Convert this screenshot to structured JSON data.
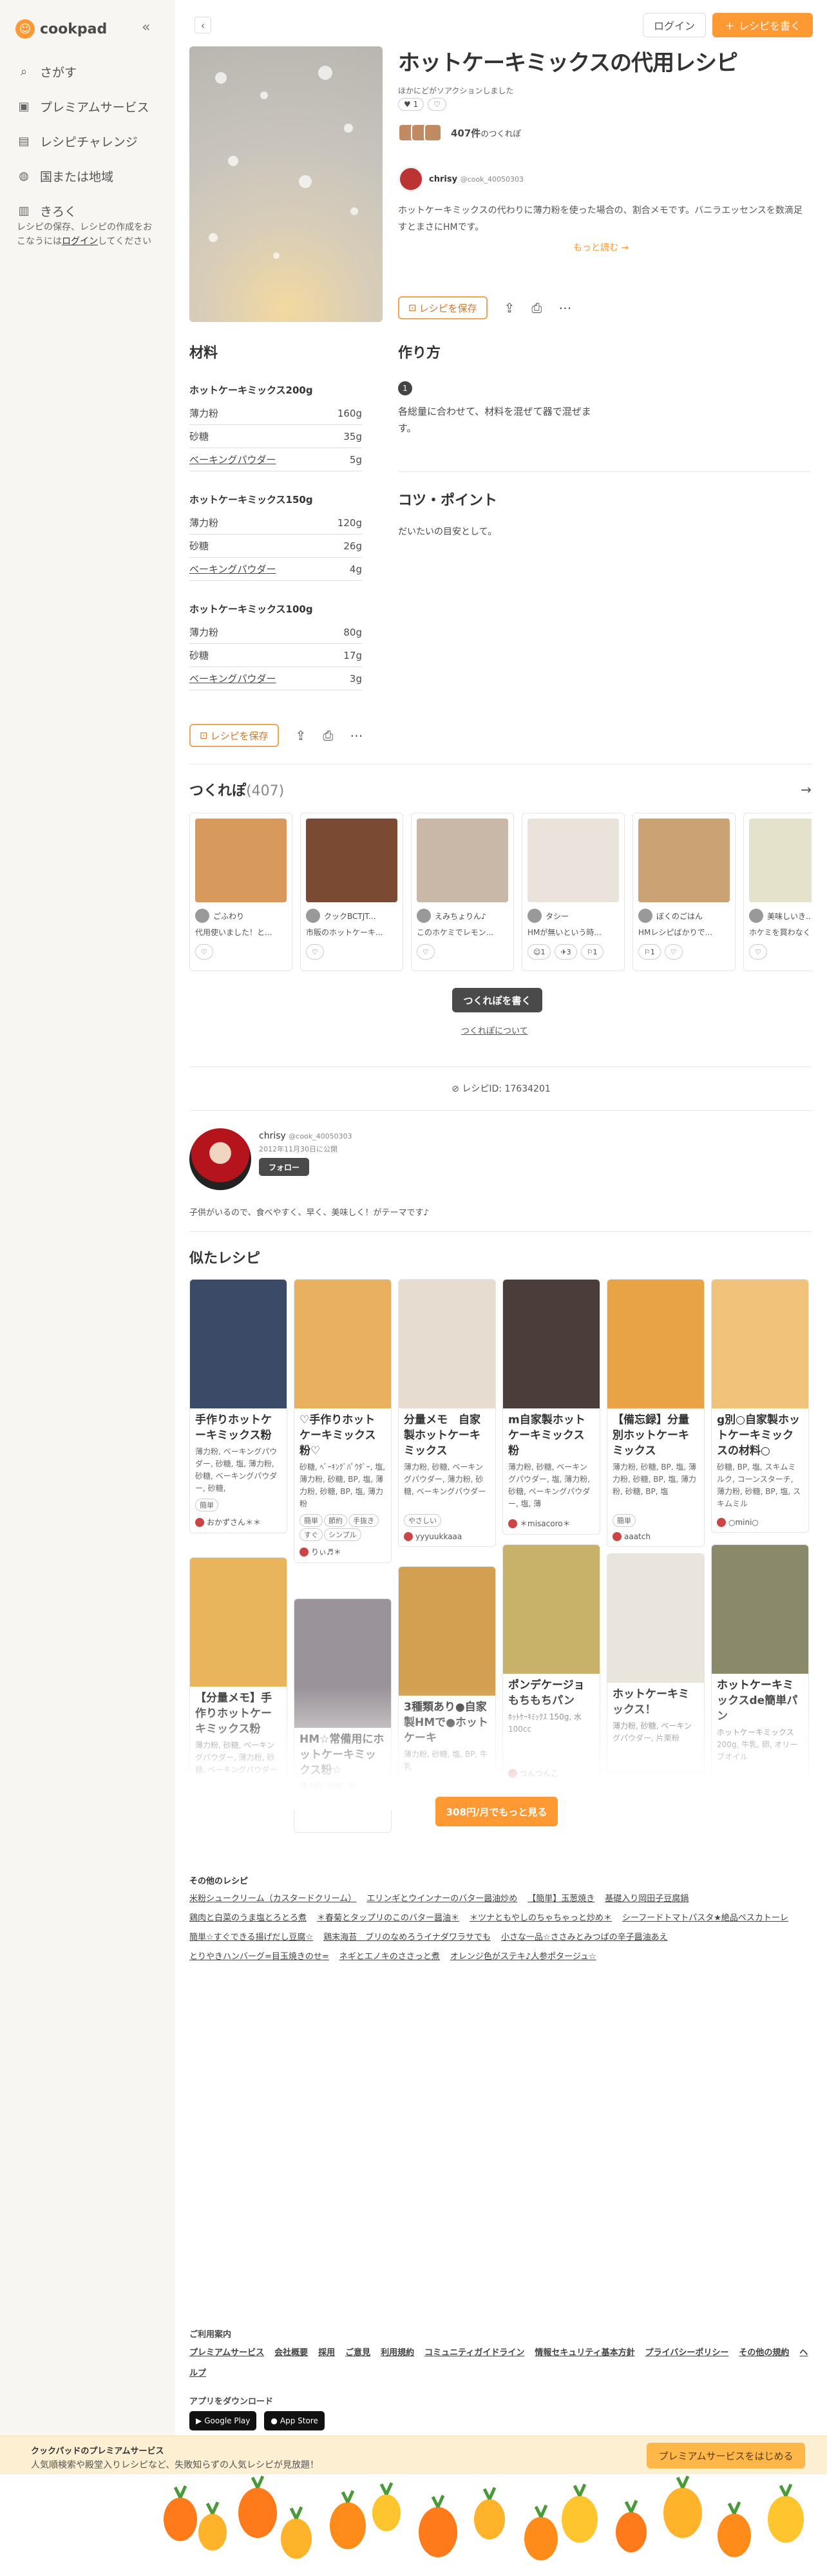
{
  "brand": {
    "name": "cookpad"
  },
  "sidebar": {
    "items": [
      {
        "icon": "search-icon",
        "label": "さがす"
      },
      {
        "icon": "premium-icon",
        "label": "プレミアムサービス"
      },
      {
        "icon": "challenge-icon",
        "label": "レシピチャレンジ"
      },
      {
        "icon": "globe-icon",
        "label": "国または地域"
      },
      {
        "icon": "book-icon",
        "label": "きろく"
      }
    ],
    "note_before": "レシピの保存、レシピの作成をおこなうには",
    "note_link": "ログイン",
    "note_after": "してください"
  },
  "header": {
    "login": "ログイン",
    "write": "レシピを書く"
  },
  "recipe": {
    "title": "ホットケーキミックスの代用レシピ",
    "subtitle": "ほかにどがソアクションしました",
    "badges": [
      "♥ 1",
      "♡"
    ],
    "tsukurepo_count": "407件",
    "tsukurepo_suffix": "のつくれぽ",
    "author_name": "chrisy",
    "author_id": "@cook_40050303",
    "description": "ホットケーキミックスの代わりに薄力粉を使った場合の、割合メモです。バニラエッセンスを数滴足すとまさにHMです。\nこのレシピの生い立ち...",
    "more": "もっと読む →",
    "save": "レシピを保存",
    "ingredients_title": "材料",
    "steps_title": "作り方",
    "step_num": "1",
    "step_text": "各総量に合わせて、材料を混ぜて器で混ぜます。",
    "tips_title": "コツ・ポイント",
    "tips_text": "だいたいの目安として。",
    "recipe_id": "レシピID: 17634201"
  },
  "ingredient_groups": [
    {
      "title": "ホットケーキミックス200g",
      "rows": [
        {
          "name": "薄力粉",
          "qty": "160g",
          "link": false
        },
        {
          "name": "砂糖",
          "qty": "35g",
          "link": false
        },
        {
          "name": "ベーキングパウダー",
          "qty": "5g",
          "link": true
        }
      ]
    },
    {
      "title": "ホットケーキミックス150g",
      "rows": [
        {
          "name": "薄力粉",
          "qty": "120g",
          "link": false
        },
        {
          "name": "砂糖",
          "qty": "26g",
          "link": false
        },
        {
          "name": "ベーキングパウダー",
          "qty": "4g",
          "link": true
        }
      ]
    },
    {
      "title": "ホットケーキミックス100g",
      "rows": [
        {
          "name": "薄力粉",
          "qty": "80g",
          "link": false
        },
        {
          "name": "砂糖",
          "qty": "17g",
          "link": false
        },
        {
          "name": "ベーキングパウダー",
          "qty": "3g",
          "link": true
        }
      ]
    }
  ],
  "tsukurepo": {
    "title": "つくれぽ",
    "count": "(407)",
    "cards": [
      {
        "user": "ごふわり",
        "text": "代用使いました！と...",
        "chips": [
          "♡"
        ],
        "color": "#d89a5c"
      },
      {
        "user": "クックBCTJT...",
        "text": "市販のホットケーキ...",
        "chips": [
          "♡"
        ],
        "color": "#7a4a32"
      },
      {
        "user": "えみちょりん♪",
        "text": "このホケミでレモン...",
        "chips": [
          "♡"
        ],
        "color": "#c9b8a8"
      },
      {
        "user": "タシー",
        "text": "HMが無いという時...",
        "chips": [
          "☺1",
          "✈3",
          "⚐1"
        ],
        "color": "#e9e3dc"
      },
      {
        "user": "ぼくのごはん",
        "text": "HMレシピばかりで...",
        "chips": [
          "⚐1",
          "♡"
        ],
        "color": "#caa273"
      },
      {
        "user": "美味しいき...",
        "text": "ホケミを買わなく...",
        "chips": [
          "♡"
        ],
        "color": "#e5e2cc"
      }
    ],
    "write_btn": "つくれぽを書く",
    "about": "つくれぽについて"
  },
  "profile": {
    "name": "chrisy",
    "id": "@cook_40050303",
    "date": "2012年11月30日に公開",
    "follow": "フォロー",
    "bio": "子供がいるので、食べやすく、早く、美味しく！がテーマです♪"
  },
  "similar": {
    "title": "似たレシピ",
    "items": [
      {
        "title": "手作りホットケーキミックス粉",
        "ing": "薄力粉, ベーキングパウダー, 砂糖, 塩, 薄力粉, 砂糖, ベーキングパウダー, 砂糖,",
        "tags": [
          "簡単"
        ],
        "user": "おかずさん＊＊",
        "color": "#3b4a66"
      },
      {
        "title": "♡手作りホットケーキミックス粉♡",
        "ing": "砂糖, ﾍﾞｰｷﾝｸﾞﾊﾟｳﾀﾞｰ, 塩, 薄力粉, 砂糖, BP, 塩, 薄力粉, 砂糖, BP, 塩, 薄力粉",
        "tags": [
          "簡単",
          "節約",
          "手抜き",
          "すぐ",
          "シンプル"
        ],
        "user": "りぃ♬＊",
        "color": "#e9b060"
      },
      {
        "title": "分量メモ　自家製ホットケーキミックス",
        "ing": "薄力粉, 砂糖, ベーキングパウダー, 薄力粉, 砂糖, ベーキングパウダー",
        "tags": [
          "やさしい"
        ],
        "user": "yyyuukkaaa",
        "color": "#e6ddd0"
      },
      {
        "title": "m自家製ホットケーキミックス粉",
        "ing": "薄力粉, 砂糖, ベーキングパウダー, 塩, 薄力粉, 砂糖, ベーキングパウダー, 塩, 薄",
        "tags": [],
        "user": "＊misacoro＊",
        "color": "#4b3d3a"
      },
      {
        "title": "【備忘録】分量別ホットケーキミックス",
        "ing": "薄力粉, 砂糖, BP, 塩, 薄力粉, 砂糖, BP, 塩, 薄力粉, 砂糖, BP, 塩",
        "tags": [
          "簡単"
        ],
        "user": "aaatch",
        "color": "#e8a444"
      },
      {
        "title": "g別○自家製ホットケーキミックスの材料○",
        "ing": "砂糖, BP, 塩, スキムミルク, コーンスターチ, 薄力粉, 砂糖, BP, 塩, スキムミル",
        "tags": [],
        "user": "○mini○",
        "color": "#f0c27a"
      },
      {
        "title": "【分量メモ】手作りホットケーキミックス粉",
        "ing": "薄力粉, 砂糖, ベーキングパウダー, 薄力粉, 砂糖, ベーキングパウダー",
        "tags": [],
        "user": "",
        "color": "#e8b45c"
      },
      {
        "title": "HM☆常備用にホットケーキミックス粉☆",
        "ing": "薄力粉, 砂糖, 塩",
        "tags": [],
        "user": "",
        "color": "#9a9399"
      },
      {
        "title": "3種類あり●自家製HMで●ホットケーキ",
        "ing": "薄力粉, 砂糖, 塩, BP, 牛乳",
        "tags": [],
        "user": "",
        "color": "#d2a050"
      },
      {
        "title": "ポンデケージョもちもちパン",
        "ing": "ﾎｯﾄｹｰｷﾐｯｸｽ 150g, 水 100cc",
        "tags": [],
        "user": "つんつんこ",
        "color": "#c8b26a"
      },
      {
        "title": "ホットケーキミックス！",
        "ing": "薄力粉, 砂糖, ベーキングパウダー, 片栗粉",
        "tags": [],
        "user": "",
        "color": "#e9e4dc"
      },
      {
        "title": "ホットケーキミックスde簡単パン",
        "ing": "ホットケーキミックス200g, 牛乳, 卵, オリーブオイル",
        "tags": [],
        "user": "",
        "color": "#8a8a6a"
      }
    ],
    "more_btn": "308円/月でもっと見る"
  },
  "other": {
    "title": "その他のレシピ",
    "links": [
      "米粉シュークリーム（カスタードクリーム）",
      "エリンギとウインナーのバター醤油炒め",
      "【簡単】玉葱焼き",
      "基礎入り岡田子豆腐鍋",
      "鶏肉と白菜のうま塩とろとろ煮",
      "＊春菊とタップリのこのバター醤油＊",
      "＊ツナともやしのちゃちゃっと炒め＊",
      "シーフードトマトパスタ★絶品ペスカトーレ",
      "簡単☆すぐできる揚げだし豆腐☆",
      "鶏末海苔　ブリのなめろうイナダワラサでも",
      "小さな一品☆ささみとみつばの辛子醤油あえ",
      "とりやきハンバーグ=目玉焼きのせ=",
      "ネギとエノキのささっと煮",
      "オレンジ色がステキ♪人参ポタージュ☆"
    ]
  },
  "footer": {
    "title": "ご利用案内",
    "links": [
      "プレミアムサービス",
      "会社概要",
      "採用",
      "ご意見",
      "利用規約",
      "コミュニティガイドライン",
      "情報セキュリティ基本方針",
      "プライバシーポリシー",
      "その他の規約",
      "ヘルプ"
    ],
    "app_title": "アプリをダウンロード",
    "google": "Google Play",
    "apple": "App Store"
  },
  "banner": {
    "title": "クックパッドのプレミアムサービス",
    "text": "人気順検索や殿堂入りレシピなど、失敗知らずの人気レシピが見放題！",
    "button": "プレミアムサービスをはじめる"
  },
  "colors": {
    "accent": "#ff9933"
  }
}
